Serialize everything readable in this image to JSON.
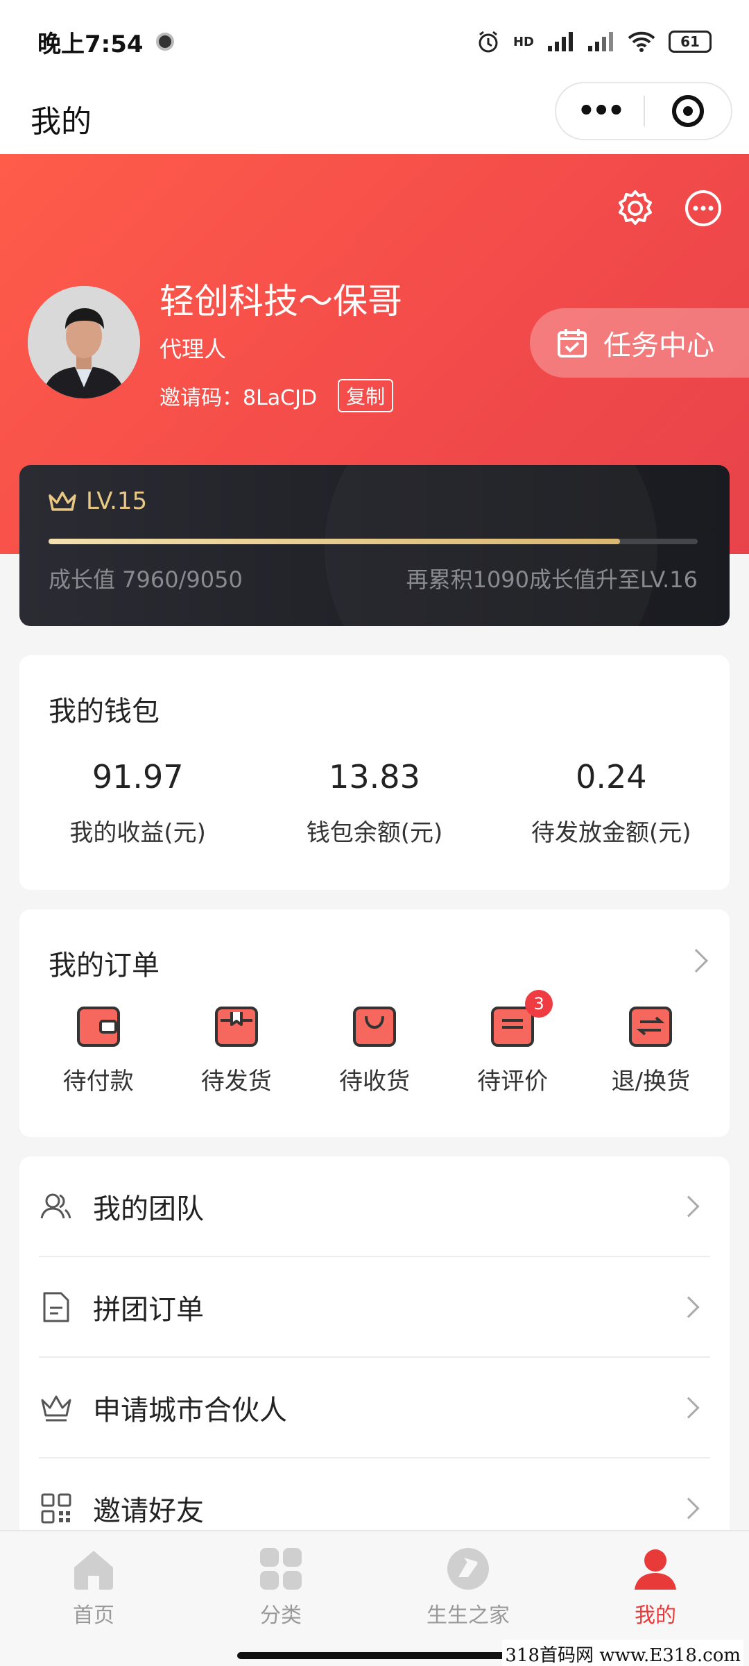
{
  "status_bar": {
    "time": "晚上7:54",
    "network": "HD",
    "battery": "61"
  },
  "nav": {
    "title": "我的",
    "more_label": "•••"
  },
  "profile": {
    "name": "轻创科技～保哥",
    "role": "代理人",
    "invite_label": "邀请码：8LaCJD",
    "copy_label": "复制",
    "task_center_label": "任务中心"
  },
  "level": {
    "label": "LV.15",
    "progress": 0.88,
    "growth_text": "成长值 7960/9050",
    "next_text": "再累积1090成长值升至LV.16"
  },
  "wallet": {
    "title": "我的钱包",
    "items": [
      {
        "value": "91.97",
        "label": "我的收益(元)"
      },
      {
        "value": "13.83",
        "label": "钱包余额(元)"
      },
      {
        "value": "0.24",
        "label": "待发放金额(元)"
      }
    ]
  },
  "orders": {
    "title": "我的订单",
    "items": [
      {
        "label": "待付款",
        "icon": "wallet-icon"
      },
      {
        "label": "待发货",
        "icon": "box-icon"
      },
      {
        "label": "待收货",
        "icon": "bag-icon"
      },
      {
        "label": "待评价",
        "icon": "comment-icon",
        "badge": "3"
      },
      {
        "label": "退/换货",
        "icon": "exchange-icon"
      }
    ]
  },
  "menu": {
    "items": [
      {
        "label": "我的团队",
        "icon": "team-icon"
      },
      {
        "label": "拼团订单",
        "icon": "document-icon"
      },
      {
        "label": "申请城市合伙人",
        "icon": "crown-icon"
      },
      {
        "label": "邀请好友",
        "icon": "qrcode-icon"
      }
    ]
  },
  "tabbar": {
    "items": [
      {
        "label": "首页",
        "icon": "home-icon"
      },
      {
        "label": "分类",
        "icon": "grid-icon"
      },
      {
        "label": "生生之家",
        "icon": "brand-icon"
      },
      {
        "label": "我的",
        "icon": "person-icon",
        "active": true
      }
    ]
  },
  "watermark": "318首码网 www.E318.com",
  "colors": {
    "accent": "#e93a3a",
    "header": "#f24a4a",
    "gold": "#e9c784"
  }
}
